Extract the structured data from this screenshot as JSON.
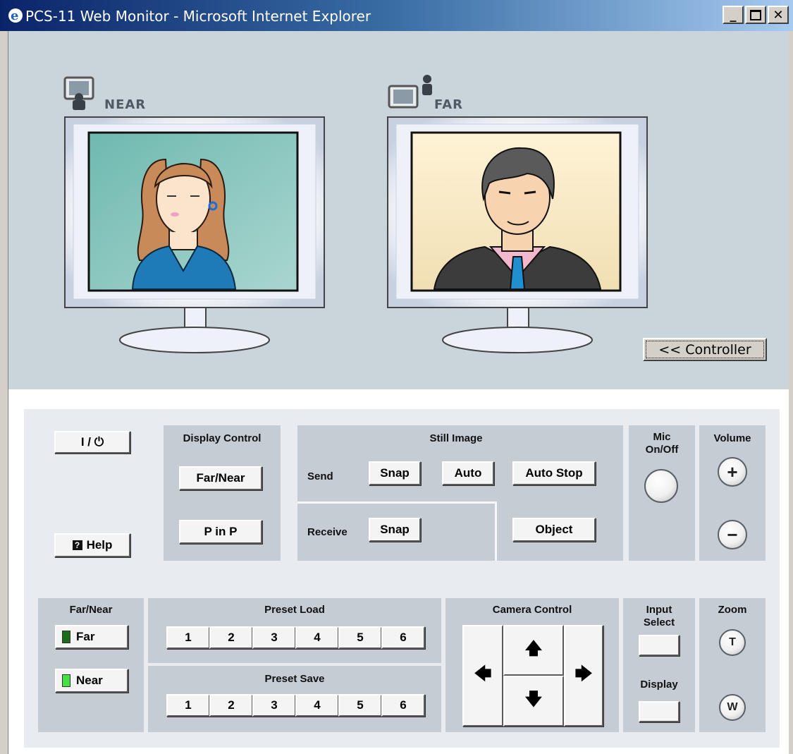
{
  "window": {
    "title": "PCS-11 Web Monitor - Microsoft Internet Explorer"
  },
  "viewer": {
    "near_label": "NEAR",
    "far_label": "FAR",
    "controller_toggle": "<< Controller"
  },
  "controls": {
    "power_label": "I / ⏻",
    "help_label": "Help",
    "display_control": {
      "title": "Display Control",
      "far_near": "Far/Near",
      "pinp": "P in P"
    },
    "still_image": {
      "title": "Still Image",
      "send_label": "Send",
      "receive_label": "Receive",
      "snap": "Snap",
      "auto": "Auto",
      "autostop": "Auto Stop",
      "receive_snap": "Snap",
      "object": "Object"
    },
    "mic": {
      "title": "Mic On/Off"
    },
    "volume": {
      "title": "Volume",
      "plus": "+",
      "minus": "−"
    },
    "far_near": {
      "title": "Far/Near",
      "far": "Far",
      "near": "Near"
    },
    "preset_load": {
      "title": "Preset Load",
      "buttons": [
        "1",
        "2",
        "3",
        "4",
        "5",
        "6"
      ]
    },
    "preset_save": {
      "title": "Preset Save",
      "buttons": [
        "1",
        "2",
        "3",
        "4",
        "5",
        "6"
      ]
    },
    "camera_control": {
      "title": "Camera Control",
      "up": "🡅",
      "down": "🡇",
      "left": "🡄",
      "right": "🡆"
    },
    "input_select": {
      "title": "Input Select",
      "display_title": "Display"
    },
    "zoom": {
      "title": "Zoom",
      "tele": "T",
      "wide": "W"
    }
  },
  "colors": {
    "far_led": "#1a6e1a",
    "near_led": "#44e044",
    "viewer_bg": "#c9d5db",
    "panel_bg": "#c5ccd4"
  }
}
